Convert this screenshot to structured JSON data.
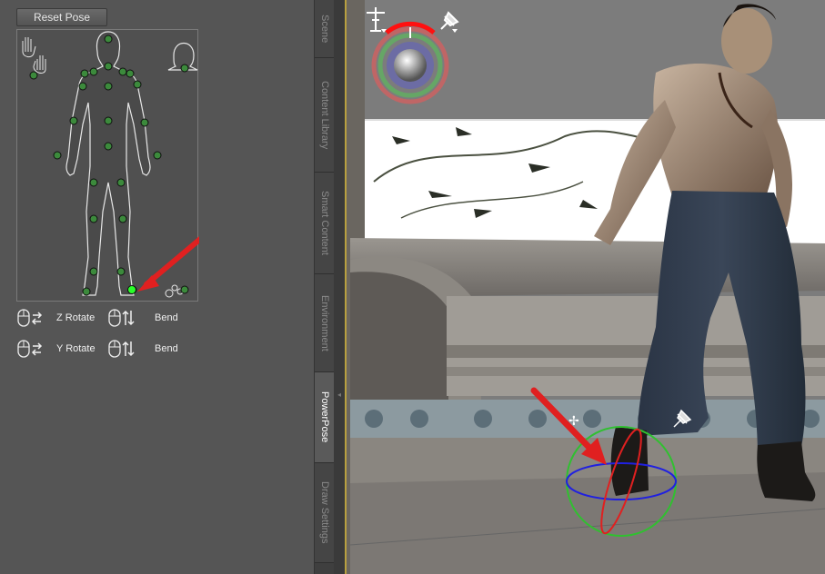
{
  "powerpose": {
    "reset_label": "Reset Pose",
    "controls": [
      {
        "left_label": "Z Rotate",
        "right_label": "Bend"
      },
      {
        "left_label": "Y Rotate",
        "right_label": "Bend"
      }
    ]
  },
  "tabs": [
    {
      "label": "Scene",
      "active": false
    },
    {
      "label": "Content Library",
      "active": false
    },
    {
      "label": "Smart Content",
      "active": false
    },
    {
      "label": "Environment",
      "active": false
    },
    {
      "label": "PowerPose",
      "active": true
    },
    {
      "label": "Draw Settings",
      "active": false
    }
  ],
  "colors": {
    "panel_bg": "#555555",
    "node_green": "#3c8a3c",
    "node_selected": "#2aff2a",
    "arrow_red": "#e02020"
  },
  "icons": [
    "hand-left-icon",
    "hand-right-icon",
    "head-icon",
    "foot-icon",
    "mouse-left-drag-icon",
    "mouse-right-drag-icon",
    "joint-tool-icon",
    "pin-icon"
  ]
}
